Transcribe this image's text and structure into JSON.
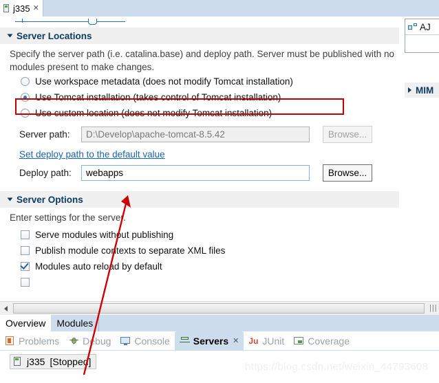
{
  "editor": {
    "tab": {
      "label": "j335",
      "close": "✕",
      "icon": "server-file-icon"
    }
  },
  "sections": {
    "server_locations": {
      "title": "Server Locations",
      "description": "Specify the server path (i.e. catalina.base) and deploy path. Server must be published with no modules present to make changes.",
      "radios": [
        {
          "label": "Use workspace metadata (does not modify Tomcat installation)",
          "checked": false
        },
        {
          "label": "Use Tomcat installation (takes control of Tomcat installation)",
          "checked": true
        },
        {
          "label": "Use custom location (does not modify Tomcat installation)",
          "checked": false
        }
      ],
      "server_path": {
        "label": "Server path:",
        "value": "D:\\Develop\\apache-tomcat-8.5.42",
        "browse_label": "Browse...",
        "enabled": false
      },
      "default_link": "Set deploy path to the default value",
      "deploy_path": {
        "label": "Deploy path:",
        "value": "webapps",
        "browse_label": "Browse...",
        "enabled": true
      }
    },
    "server_options": {
      "title": "Server Options",
      "description": "Enter settings for the server.",
      "checkboxes": [
        {
          "label": "Serve modules without publishing",
          "checked": false
        },
        {
          "label": "Publish module contexts to separate XML files",
          "checked": false
        },
        {
          "label": "Modules auto reload by default",
          "checked": true
        }
      ]
    }
  },
  "right_panel": {
    "ajax_label": "AJ",
    "mime_label": "MIM"
  },
  "page_tabs": [
    {
      "label": "Overview",
      "active": true
    },
    {
      "label": "Modules",
      "active": false
    }
  ],
  "view_tabs": [
    {
      "label": "Problems",
      "icon": "problems-icon",
      "active": false,
      "closable": false
    },
    {
      "label": "Debug",
      "icon": "debug-icon",
      "active": false,
      "closable": false
    },
    {
      "label": "Console",
      "icon": "console-icon",
      "active": false,
      "closable": false
    },
    {
      "label": "Servers",
      "icon": "servers-icon",
      "active": true,
      "closable": true,
      "close": "✕"
    },
    {
      "label": "JUnit",
      "icon": "junit-icon",
      "icon_text": "Ju",
      "active": false,
      "closable": false
    },
    {
      "label": "Coverage",
      "icon": "coverage-icon",
      "active": false,
      "closable": false
    }
  ],
  "servers_view": {
    "row": {
      "name": "j335",
      "state": "[Stopped]",
      "icon": "server-icon"
    }
  },
  "watermark": "https://blog.csdn.net/weixin_44793608",
  "colors": {
    "section_title": "#0d3c61",
    "link": "#1a64b4",
    "annotation": "#cc0000",
    "tab_strip": "#cdddee",
    "section_header_bg": "#f0f0f0"
  }
}
